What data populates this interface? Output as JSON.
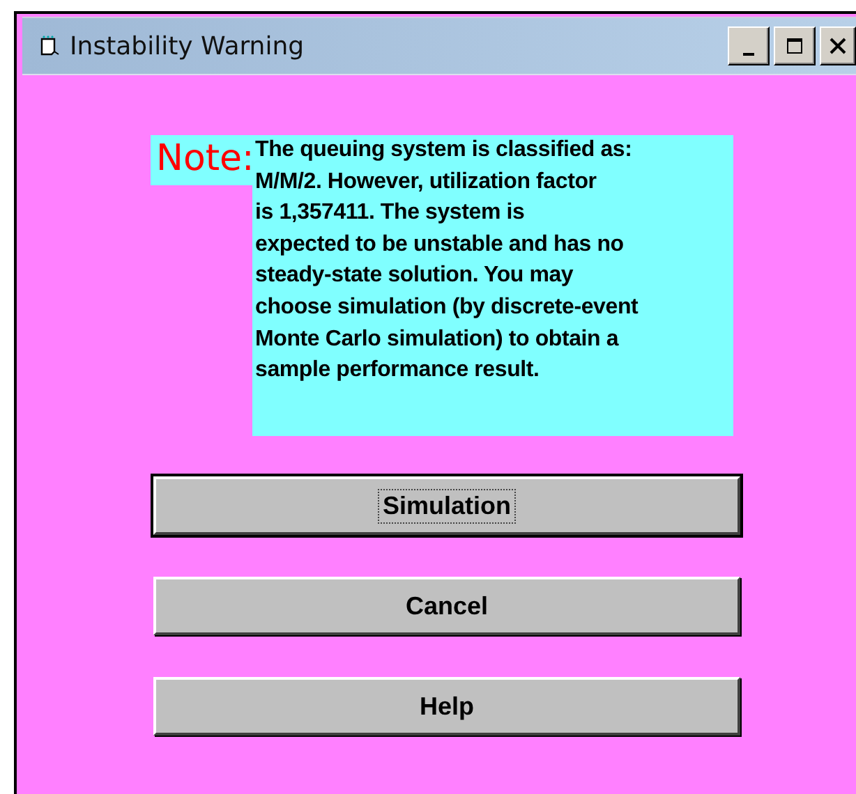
{
  "window": {
    "title": "Instability Warning"
  },
  "note": {
    "label": "Note:",
    "lines": [
      "The queuing system is classified as:",
      "M/M/2.  However, utilization factor",
      "is 1,357411.  The system is",
      "expected to be unstable and has no",
      "steady-state solution.  You may",
      "choose simulation (by discrete-event",
      "Monte Carlo simulation) to obtain a",
      "sample performance result."
    ]
  },
  "buttons": [
    {
      "label": "Simulation",
      "default": true,
      "focused": true
    },
    {
      "label": "Cancel",
      "default": false,
      "focused": false
    },
    {
      "label": "Help",
      "default": false,
      "focused": false
    }
  ]
}
